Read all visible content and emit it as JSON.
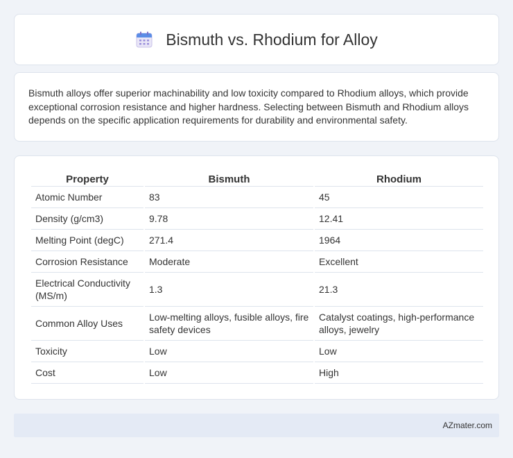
{
  "header": {
    "title": "Bismuth vs. Rhodium for Alloy",
    "icon": "calendar-icon"
  },
  "intro": {
    "text": "Bismuth alloys offer superior machinability and low toxicity compared to Rhodium alloys, which provide exceptional corrosion resistance and higher hardness. Selecting between Bismuth and Rhodium alloys depends on the specific application requirements for durability and environmental safety."
  },
  "table": {
    "headers": [
      "Property",
      "Bismuth",
      "Rhodium"
    ],
    "rows": [
      [
        "Atomic Number",
        "83",
        "45"
      ],
      [
        "Density (g/cm3)",
        "9.78",
        "12.41"
      ],
      [
        "Melting Point (degC)",
        "271.4",
        "1964"
      ],
      [
        "Corrosion Resistance",
        "Moderate",
        "Excellent"
      ],
      [
        "Electrical Conductivity (MS/m)",
        "1.3",
        "21.3"
      ],
      [
        "Common Alloy Uses",
        "Low-melting alloys, fusible alloys, fire safety devices",
        "Catalyst coatings, high-performance alloys, jewelry"
      ],
      [
        "Toxicity",
        "Low",
        "Low"
      ],
      [
        "Cost",
        "Low",
        "High"
      ]
    ]
  },
  "footer": {
    "brand": "AZmater.com"
  },
  "colors": {
    "page_background": "#f0f3f8",
    "card_background": "#ffffff",
    "footer_background": "#e4eaf5"
  }
}
